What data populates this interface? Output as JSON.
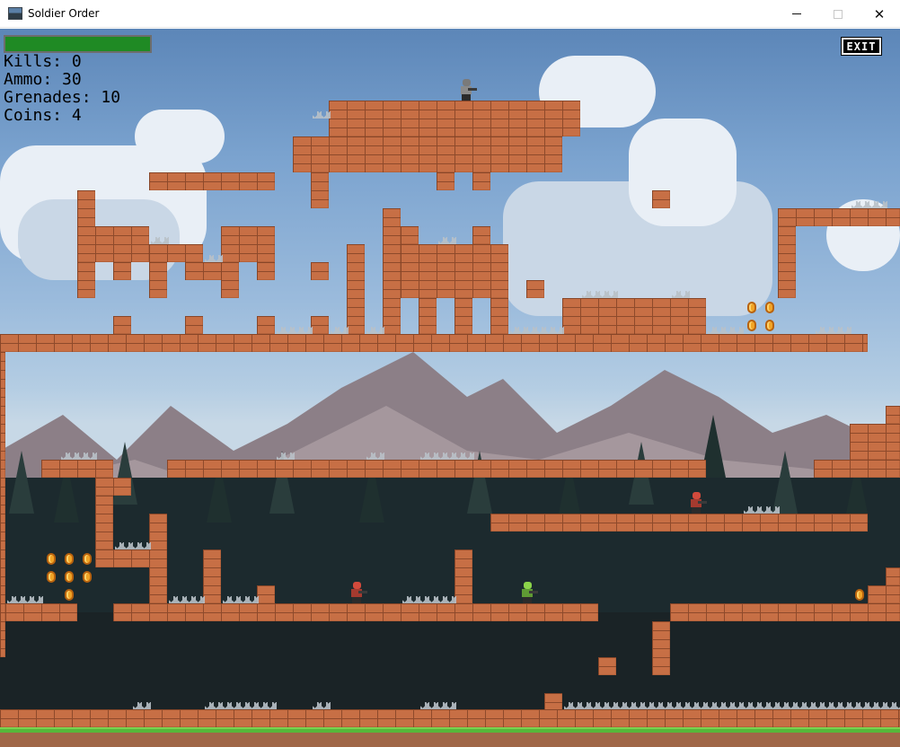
{
  "window": {
    "title": "Soldier Order",
    "minimize_label": "",
    "maximize_label": "",
    "close_label": "✕"
  },
  "hud": {
    "kills": "Kills: 0",
    "ammo": "Ammo: 30",
    "grenades": "Grenades: 10",
    "coins": "Coins: 4",
    "health_fraction": 1.0,
    "exit_label": "EXIT"
  },
  "colors": {
    "health": "#1f8a24",
    "brick": "#c76f45",
    "sky": "#7ba3cf",
    "grass": "#56b83a"
  },
  "entities": {
    "player": "player-soldier",
    "enemies": [
      "enemy-soldier-red",
      "enemy-soldier-red",
      "enemy-soldier-green"
    ],
    "coins_visible": 13
  }
}
